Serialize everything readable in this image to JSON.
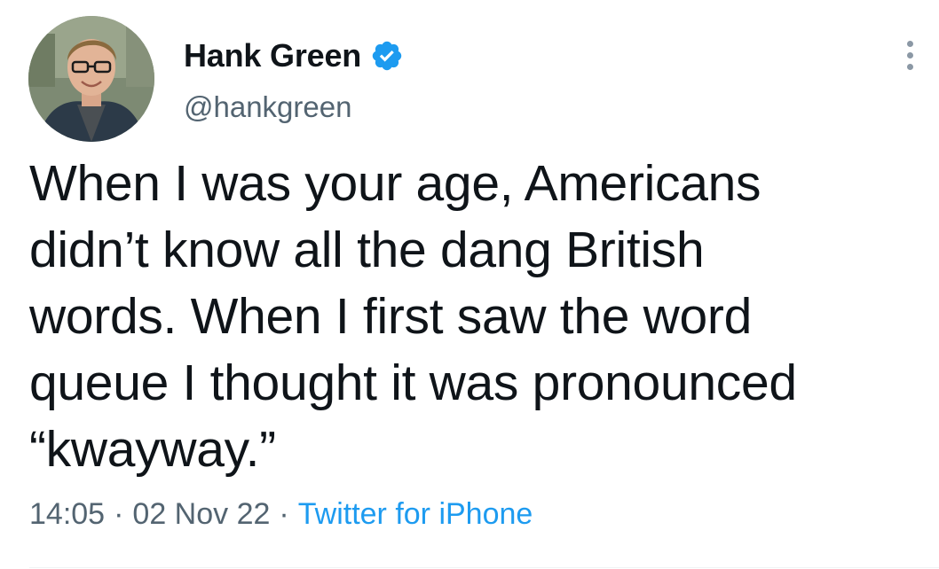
{
  "author": {
    "display_name": "Hank Green",
    "handle": "@hankgreen",
    "verified": true
  },
  "tweet": {
    "text": "When I was your age, Americans\ndidn’t know all the dang British\nwords. When I first saw the word\nqueue I thought it was pronounced\n“kwayway.”",
    "time": "14:05",
    "date": "02 Nov 22",
    "separator": "·",
    "source": "Twitter for iPhone"
  },
  "icons": {
    "verified_badge": "verified-badge-icon",
    "more": "more-options-icon"
  },
  "colors": {
    "text_primary": "#0f1419",
    "text_secondary": "#536471",
    "accent": "#1d9bf0"
  }
}
